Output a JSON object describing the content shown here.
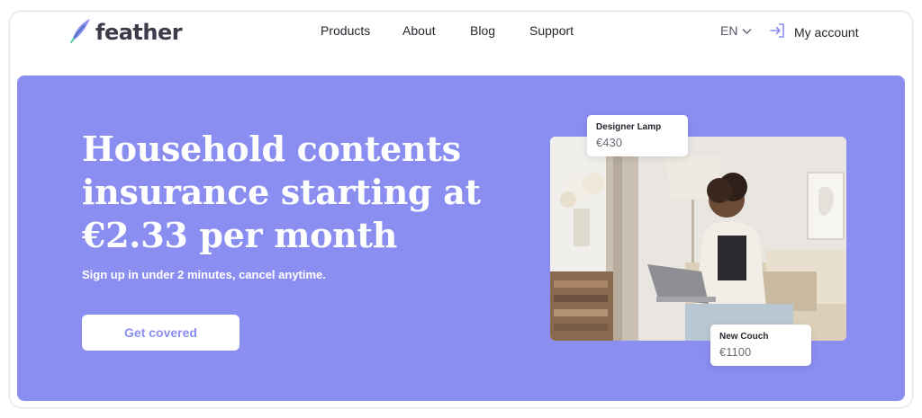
{
  "brand": {
    "name": "feather",
    "accent": "#8b8ef1"
  },
  "nav": {
    "items": [
      {
        "label": "Products"
      },
      {
        "label": "About"
      },
      {
        "label": "Blog"
      },
      {
        "label": "Support"
      }
    ],
    "language": "EN",
    "language_icon": "chevron-down-icon",
    "account_label": "My account",
    "account_icon": "sign-in-icon"
  },
  "hero": {
    "headline_line1": "Household contents",
    "headline_line2": "insurance starting at",
    "headline_line3": "€2.33 per month",
    "subline": "Sign up in under 2 minutes, cancel anytime.",
    "cta_label": "Get covered",
    "background": "#8b8ef1"
  },
  "tags": {
    "lamp": {
      "name": "Designer Lamp",
      "price": "€430"
    },
    "couch": {
      "name": "New Couch",
      "price": "€1100"
    }
  }
}
